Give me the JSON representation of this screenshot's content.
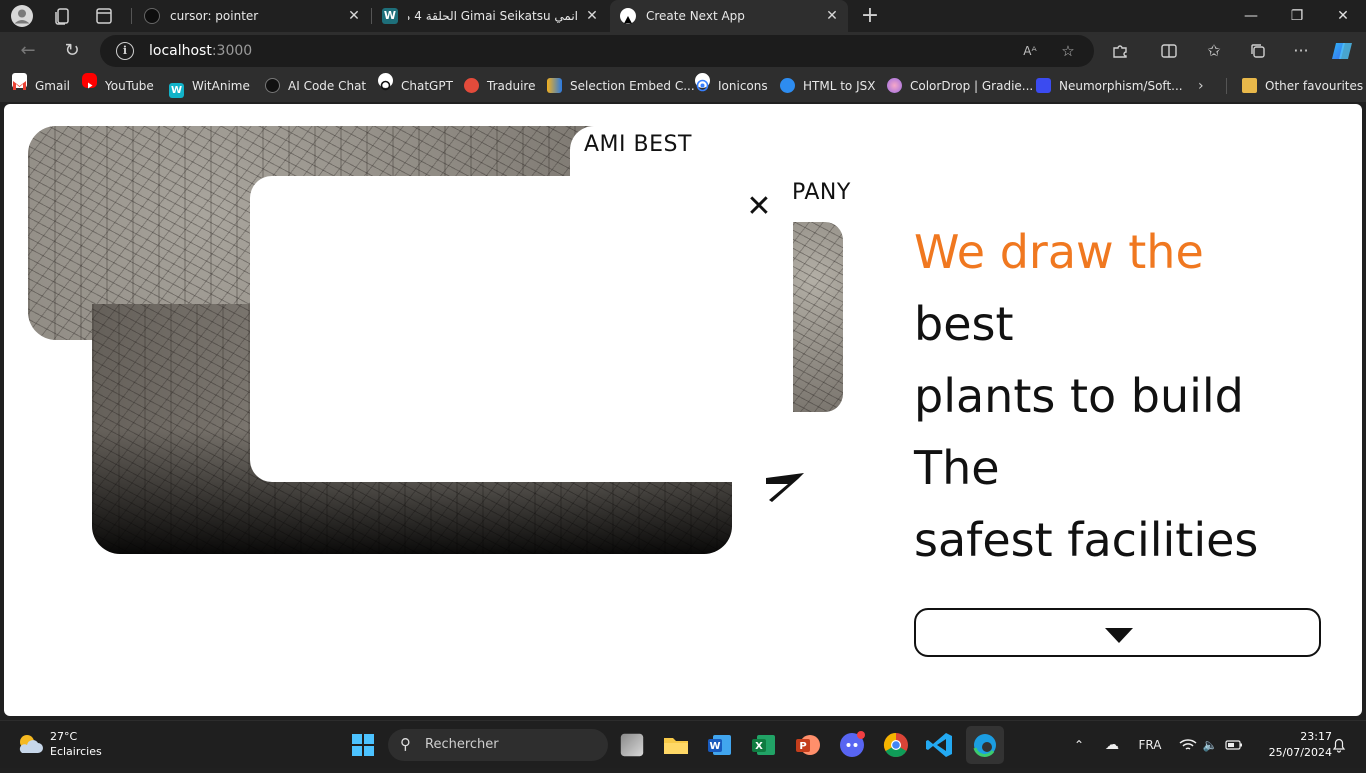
{
  "browser": {
    "tabs": [
      {
        "title": "cursor: pointer",
        "active": false
      },
      {
        "title": "انمي Gimai Seikatsu الحلقة 4 مترج",
        "active": false
      },
      {
        "title": "Create Next App",
        "active": true
      }
    ],
    "new_tab_symbol": "+",
    "url_host": "localhost",
    "url_port": ":3000",
    "bookmarks": [
      "Gmail",
      "YouTube",
      "WitAnime",
      "AI Code Chat",
      "ChatGPT",
      "Traduire",
      "Selection Embed C...",
      "Ionicons",
      "HTML to JSX",
      "ColorDrop | Gradie...",
      "Neumorphism/Soft..."
    ],
    "other_favourites": "Other favourites"
  },
  "page": {
    "brand_line1": "AMI BEST",
    "brand_line2": "PANY",
    "close_symbol": "✕",
    "headline": {
      "highlight": "We draw the",
      "lines": [
        "best",
        "plants to build",
        "The",
        "safest facilities"
      ]
    },
    "accent_color": "#f07820"
  },
  "taskbar": {
    "temperature": "27°C",
    "weather": "Eclaircies",
    "search_placeholder": "Rechercher",
    "language": "FRA",
    "time": "23:17",
    "date": "25/07/2024"
  }
}
